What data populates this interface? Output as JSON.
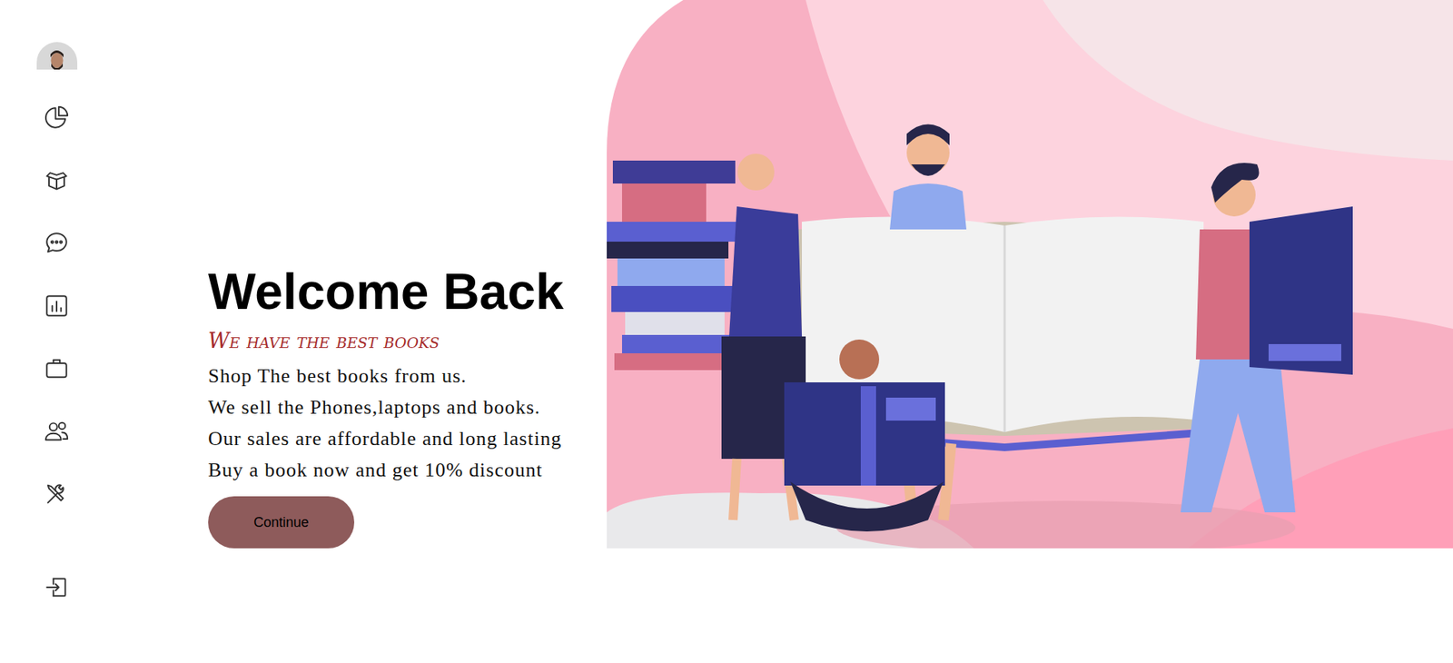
{
  "hero": {
    "title": "Welcome Back",
    "subtitle": "We have the best books",
    "lines": [
      "Shop The best books from us.",
      "We sell the Phones,laptops and books.",
      "Our sales are affordable and long lasting",
      "Buy a book now and get 10% discount"
    ],
    "button": "Continue"
  }
}
